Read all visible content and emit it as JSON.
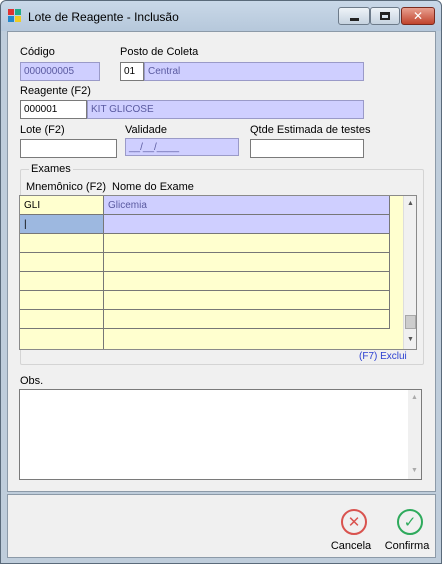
{
  "window": {
    "title": "Lote de Reagente - Inclusão",
    "controls": {
      "minimize": "▭",
      "maximize": "▣",
      "close": "✕"
    }
  },
  "form": {
    "codigo": {
      "label": "Código",
      "value": "000000005"
    },
    "posto": {
      "label": "Posto de Coleta",
      "code": "01",
      "name": "Central"
    },
    "reagente": {
      "label": "Reagente (F2)",
      "code": "000001",
      "name": "KIT GLICOSE"
    },
    "lote": {
      "label": "Lote (F2)",
      "value": ""
    },
    "validade": {
      "label": "Validade",
      "value": "__/__/____"
    },
    "qtde": {
      "label": "Qtde Estimada de testes",
      "value": ""
    }
  },
  "exames": {
    "group_label": "Exames",
    "columns": [
      "Mnemônico (F2)",
      "Nome do Exame"
    ],
    "rows": [
      {
        "mnemonico": "GLI",
        "nome": "Glicemia"
      },
      {
        "mnemonico": "|",
        "nome": ""
      },
      {
        "mnemonico": "",
        "nome": ""
      },
      {
        "mnemonico": "",
        "nome": ""
      },
      {
        "mnemonico": "",
        "nome": ""
      },
      {
        "mnemonico": "",
        "nome": ""
      },
      {
        "mnemonico": "",
        "nome": ""
      }
    ],
    "exclui_label": "(F7) Exclui"
  },
  "obs": {
    "label": "Obs.",
    "value": ""
  },
  "actions": {
    "cancela": "Cancela",
    "confirma": "Confirma"
  },
  "colors": {
    "readonly_bg": "#cfcfff",
    "grid_bg": "#ffffcf",
    "selected_cell": "#9db8e0",
    "cancel_red": "#d9534f",
    "confirm_green": "#2eaa5c",
    "link_blue": "#2b3fd1"
  }
}
